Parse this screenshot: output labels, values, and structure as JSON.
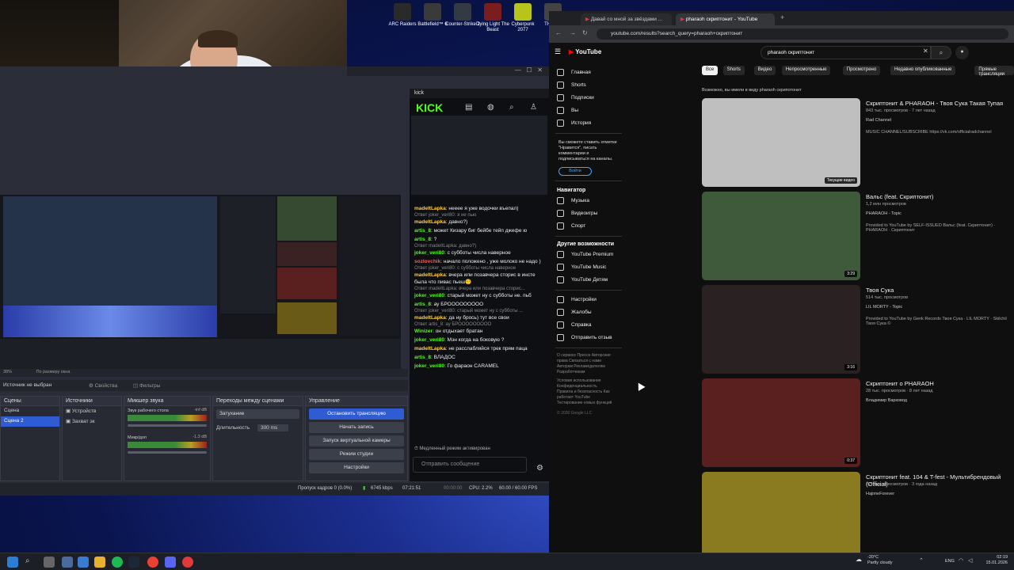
{
  "desktop": {
    "icons": [
      {
        "label": "ARC Raiders",
        "color": "#2a2a2a"
      },
      {
        "label": "Battlefield™ 6",
        "color": "#3a3a3a"
      },
      {
        "label": "Counter-Strike 2",
        "color": "#333a44"
      },
      {
        "label": "Dying Light The Beast",
        "color": "#7a1d1d"
      },
      {
        "label": "Cyberpunk 2077",
        "color": "#b8c41a"
      },
      {
        "label": "THE F...",
        "color": "#444"
      }
    ]
  },
  "obs": {
    "zoom_label": "38%",
    "fit_label": "По размеру окна",
    "source_status": "Источник не выбран",
    "props_button": "Свойства",
    "filters_button": "Фильтры",
    "panels": {
      "scenes": {
        "title": "Сцены",
        "items": [
          "Сцена",
          "Сцена 2"
        ],
        "selected": 1
      },
      "sources": {
        "title": "Источники",
        "items": [
          "Устройств",
          "Захват эк"
        ]
      },
      "mixer": {
        "title": "Микшер звука",
        "channels": [
          {
            "name": "Звук рабочего стола",
            "db": "-inf dB"
          },
          {
            "name": "Микр/доп",
            "db": "-1.3 dB"
          }
        ]
      },
      "transitions": {
        "title": "Переходы между сценами",
        "type": "Затухание",
        "duration_label": "Длительность",
        "duration_value": "300 ms"
      },
      "controls": {
        "title": "Управление",
        "buttons": [
          "Остановить трансляцию",
          "Начать запись",
          "Запуск виртуальной камеры",
          "Режим студии",
          "Настройки"
        ]
      }
    },
    "status": {
      "dropped": "Пропуск кадров 0 (0.0%)",
      "bitrate": "6745 kbps",
      "stream_time": "07:21:51",
      "rec_time": "00:00:00",
      "cpu": "CPU: 2.2%",
      "fps": "60.00 / 60.00 FPS"
    }
  },
  "kick": {
    "window_title": "kick",
    "logo": "KICK",
    "messages": [
      {
        "user": "madeItLapka",
        "color": "y",
        "text": "нееее я уже водочки въепал)",
        "reply": ""
      },
      {
        "user": "",
        "color": "",
        "text": "",
        "reply": "Ответ joker_veri80: я не пью"
      },
      {
        "user": "madeItLapka",
        "color": "y",
        "text": "давно?)",
        "reply": ""
      },
      {
        "user": "artis_8",
        "color": "g",
        "text": "может Кизару биг бейбе тейп джефе ю",
        "reply": ""
      },
      {
        "user": "artis_8",
        "color": "g",
        "text": "?",
        "reply": ""
      },
      {
        "user": "joker_veri80",
        "color": "g",
        "text": "с субботы числа наверное",
        "reply": "Ответ madeItLapka: давно?)"
      },
      {
        "user": "sozlovchik",
        "color": "r",
        "text": "начало положено , уже молоко не надо )",
        "reply": ""
      },
      {
        "user": "madeItLapka",
        "color": "y",
        "text": "вчера или позавчера сторис в инсте была что пивас пьеш🤨",
        "reply": "Ответ joker_veri80: с субботы числа наверное"
      },
      {
        "user": "joker_veri80",
        "color": "g",
        "text": "старый может ну с субботы не. пьб",
        "reply": "Ответ madeItLapka: вчера или позавчера сторис..."
      },
      {
        "user": "artis_8",
        "color": "g",
        "text": "ау БРООООООООО",
        "reply": ""
      },
      {
        "user": "madeItLapka",
        "color": "y",
        "text": "да ну брось) тут все свои",
        "reply": "Ответ joker_veri80: старый может ну с субботы ..."
      },
      {
        "user": "Winizer",
        "color": "g",
        "text": "он отдыхает братан",
        "reply": "Ответ artis_8: ау БРООООООООО"
      },
      {
        "user": "joker_veri80",
        "color": "g",
        "text": "Мэн когда на боковую ?",
        "reply": ""
      },
      {
        "user": "madeItLapka",
        "color": "y",
        "text": "не расслабляйся трек прям паца",
        "reply": ""
      },
      {
        "user": "artis_8",
        "color": "g",
        "text": "ВЛАДОС",
        "reply": ""
      },
      {
        "user": "joker_veri80",
        "color": "g",
        "text": "Го фараон CARAMEL",
        "reply": ""
      }
    ],
    "slow_mode": "Медленный режим активирован",
    "input_placeholder": "Отправить сообщение"
  },
  "browser": {
    "tabs": [
      {
        "label": "Давай со мной за звёздами ..."
      },
      {
        "label": "pharaoh скриптонит - YouTube"
      }
    ],
    "url": "youtube.com/results?search_query=pharaoh+скриптонит"
  },
  "youtube": {
    "logo": "YouTube",
    "search_value": "pharaoh скриптонит",
    "chips": [
      "Все",
      "Shorts",
      "Видео",
      "Непросмотренные",
      "Просмотрено",
      "Недавно опубликованные",
      "Прямые трансляции"
    ],
    "sidebar_top": [
      "Главная",
      "Shorts",
      "Подписки",
      "Вы",
      "История"
    ],
    "signin_text": "Вы сможете ставить отметки \"Нравится\", писать комментарии и подписываться на каналы.",
    "signin_button": "Войти",
    "nav_title": "Навигатор",
    "nav_items": [
      "Музыка",
      "Видеоигры",
      "Спорт"
    ],
    "more_title": "Другие возможности",
    "more_items": [
      "YouTube Premium",
      "YouTube Music",
      "YouTube Детям"
    ],
    "settings_items": [
      "Настройки",
      "Жалобы",
      "Справка",
      "Отправить отзыв"
    ],
    "footer1": "О сервисе  Прессе  Авторские права  Связаться с нами  Авторам  Рекламодателям  Разработчикам",
    "footer2": "Условия использования  Конфиденциальность  Правила и безопасность  Как работает YouTube  Тестирование новых функций",
    "copyright": "© 2026 Google LLC",
    "hint": "Возможно, вы имели в виду pharaoh скрипотонит",
    "videos": [
      {
        "title": "Скриптонит & PHARAOH - Твоя Сука Такая Тупая",
        "meta": "843 тыс. просмотров · 7 лет назад",
        "channel": "Rad Channel",
        "desc": "MUSIC CHANNEL/SUBSCRIBE https://vk.com/officialradchannel",
        "badge": "Текущие видео",
        "thumb": "#bfbfbf"
      },
      {
        "title": "Вальс (feat. Скриптонит)",
        "meta": "1,2 млн просмотров",
        "channel": "PHARAOH - Topic",
        "desc": "Provided to YouTube by SELF-ISSUED Вальс (feat. Скриптонит) · PHARAOH · Скриптонит",
        "badge": "3:29",
        "thumb": "#3f5a3a"
      },
      {
        "title": "Твоя Сука",
        "meta": "514 тыс. просмотров",
        "channel": "LIL MORTY - Topic",
        "desc": "Provided to YouTube by Genk Records Твоя Сука · LIL MORTY · Skilchil Твоя Сука ©",
        "badge": "3:16",
        "thumb": "#2a2222"
      },
      {
        "title": "Скриптонит о PHARAOH",
        "meta": "28 тыс. просмотров · 8 лет назад",
        "channel": "Владимир Варковод",
        "desc": "",
        "badge": "0:37",
        "thumb": "#5a2020"
      },
      {
        "title": "Скриптонит feat. 104 & T-fest - Мультибрендовый (Official)",
        "meta": "721 тыс. просмотров · 3 года назад",
        "channel": "HajimeForever",
        "desc": "",
        "badge": "",
        "thumb": "#8a7a20"
      }
    ]
  },
  "taskbar": {
    "weather_temp": "-20°C",
    "weather_desc": "Partly cloudy",
    "lang": "ENG",
    "time": "02:19",
    "date": "15.01.2026"
  }
}
